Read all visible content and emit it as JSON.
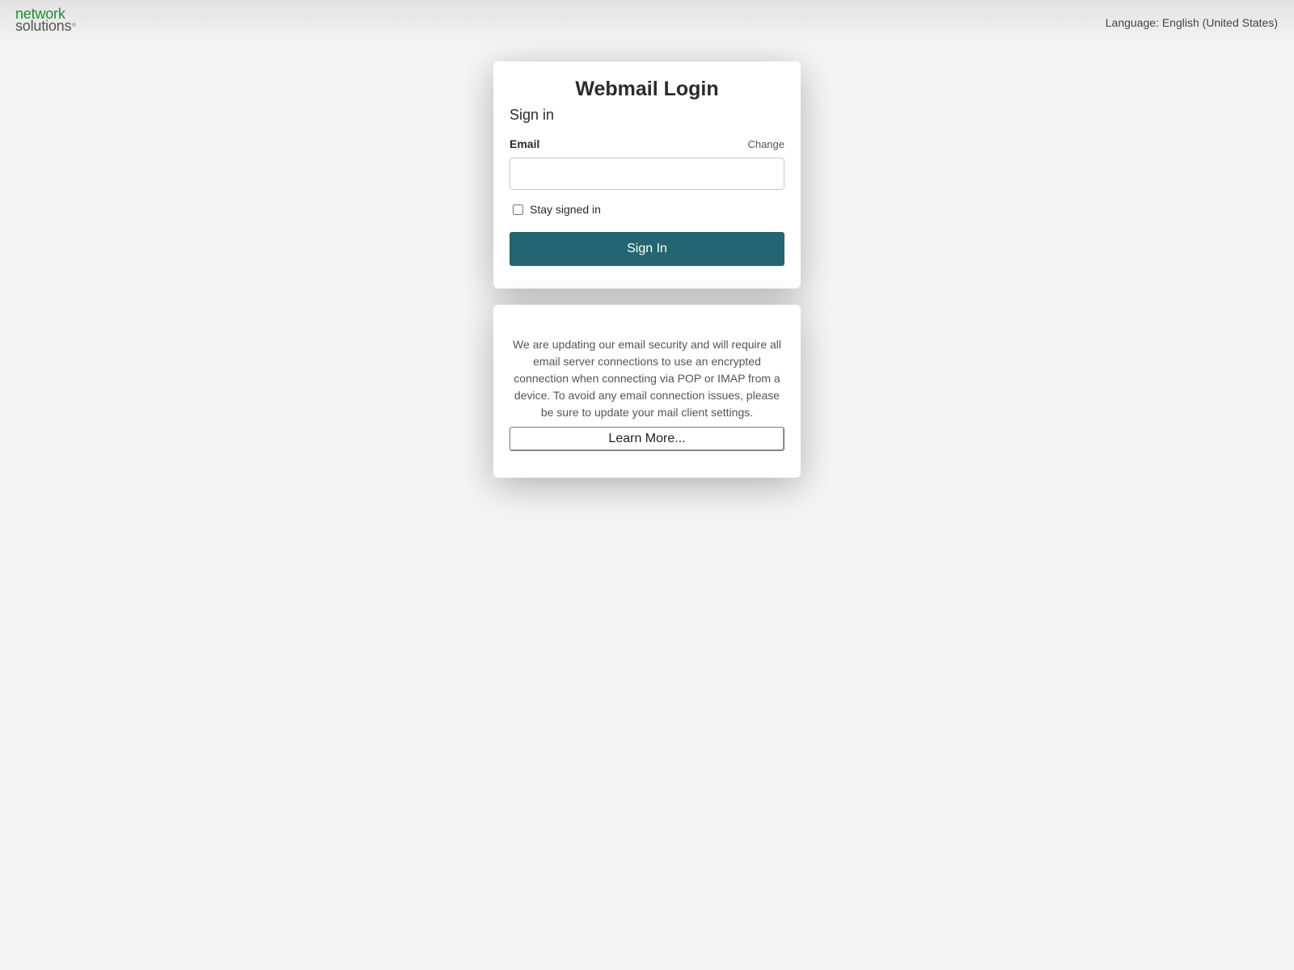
{
  "header": {
    "logo_line1": "network",
    "logo_line2": "solutions",
    "logo_mark": "®",
    "language": "Language: English (United States)"
  },
  "login": {
    "title": "Webmail Login",
    "subtitle": "Sign in",
    "email_label": "Email",
    "change_label": "Change",
    "email_value": "",
    "stay_signed_in_label": "Stay signed in",
    "stay_signed_in_checked": false,
    "sign_in_label": "Sign In"
  },
  "notice": {
    "text": "We are updating our email security and will require all email server connections to use an encrypted connection when connecting via POP or IMAP from a device. To avoid any email connection issues, please be sure to update your mail client settings.",
    "learn_more_label": "Learn More..."
  },
  "colors": {
    "brand_green": "#1f8a3c",
    "primary_button": "#236671",
    "background": "#f5f5f5"
  }
}
